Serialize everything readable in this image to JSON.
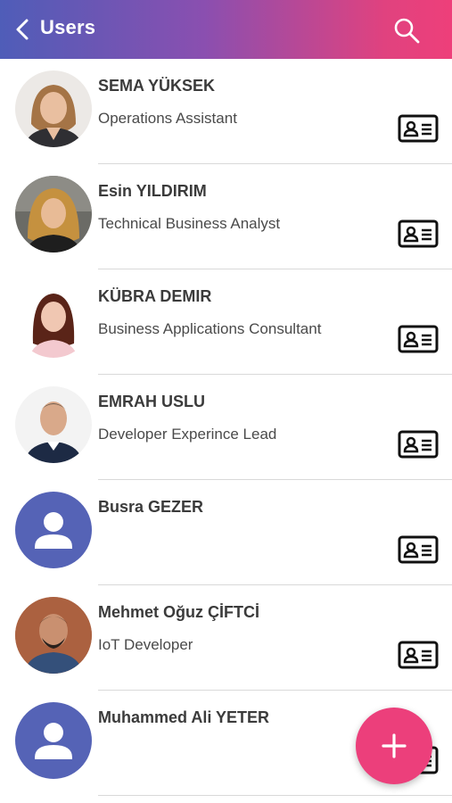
{
  "header": {
    "title": "Users",
    "back_icon": "chevron-left-icon",
    "search_icon": "search-icon"
  },
  "users": [
    {
      "name": "SEMA YÜKSEK",
      "role": "Operations Assistant",
      "avatar": "photo"
    },
    {
      "name": "Esin YILDIRIM",
      "role": "Technical Business Analyst",
      "avatar": "photo"
    },
    {
      "name": "KÜBRA DEMIR",
      "role": "Business Applications Consultant",
      "avatar": "photo"
    },
    {
      "name": "EMRAH USLU",
      "role": "Developer Experince Lead",
      "avatar": "photo"
    },
    {
      "name": "Busra GEZER",
      "role": "",
      "avatar": "placeholder"
    },
    {
      "name": "Mehmet Oğuz ÇİFTCİ",
      "role": "IoT Developer",
      "avatar": "photo"
    },
    {
      "name": "Muhammed Ali YETER",
      "role": "",
      "avatar": "placeholder"
    }
  ],
  "fab": {
    "icon": "plus-icon",
    "color": "#ec3f7b"
  },
  "colors": {
    "placeholder_avatar": "#5563b6",
    "header_start": "#4f5db8",
    "header_end": "#ee3f7a"
  }
}
